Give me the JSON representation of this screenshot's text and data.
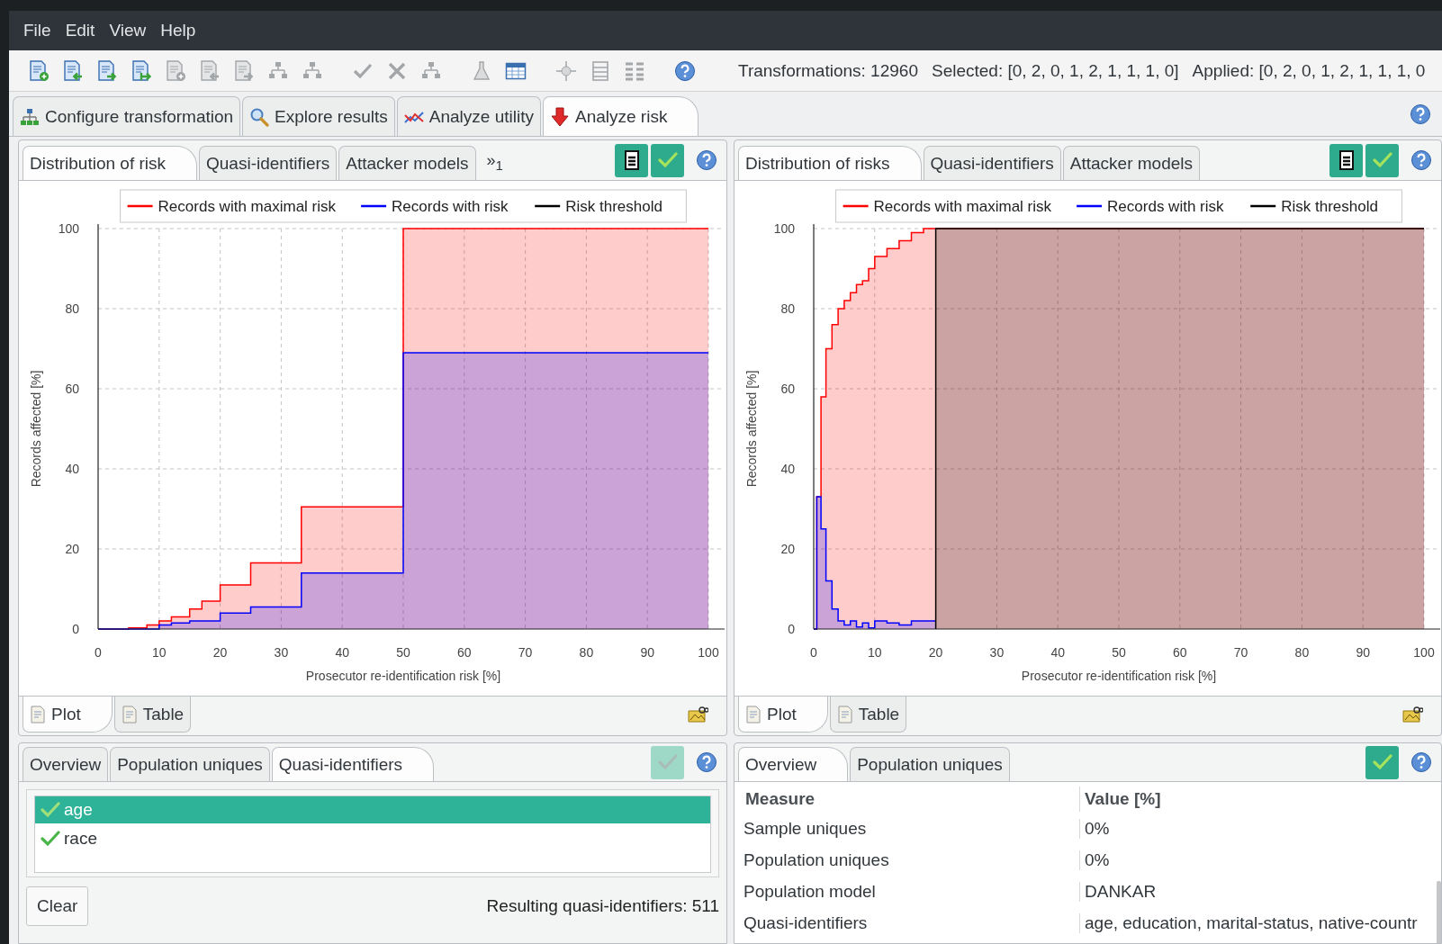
{
  "menu": [
    "File",
    "Edit",
    "View",
    "Help"
  ],
  "toolbar": {
    "buttons": [
      {
        "disabled": false
      },
      {
        "disabled": false
      },
      {
        "disabled": false
      },
      {
        "disabled": false
      },
      {
        "disabled": true
      },
      {
        "disabled": true
      },
      {
        "disabled": true
      },
      {
        "disabled": true
      },
      {
        "disabled": true
      },
      {
        "disabled": true
      },
      {
        "disabled": true
      },
      {
        "disabled": true
      },
      {
        "disabled": true
      },
      {
        "disabled": false
      },
      {
        "disabled": true
      },
      {
        "disabled": true
      },
      {
        "disabled": true
      },
      {
        "disabled": false
      }
    ],
    "transformations": "Transformations: 12960",
    "selected": "Selected: [0, 2, 0, 1, 2, 1, 1, 1, 0]",
    "applied": "Applied: [0, 2, 0, 1, 2, 1, 1, 1, 0"
  },
  "main_tabs": [
    {
      "label": "Configure transformation",
      "selected": false
    },
    {
      "label": "Explore results",
      "selected": false
    },
    {
      "label": "Analyze utility",
      "selected": false
    },
    {
      "label": "Analyze risk",
      "selected": true
    }
  ],
  "risk_panels": [
    {
      "tabs": [
        {
          "label": "Distribution of risk",
          "selected": true
        },
        {
          "label": "Quasi-identifiers",
          "selected": false
        },
        {
          "label": "Attacker models",
          "selected": false
        }
      ],
      "overflow": "»$_{1}$",
      "chart_data": {
        "type": "area",
        "xlabel": "Prosecutor re-identification risk [%]",
        "ylabel": "Records affected [%]",
        "x": [
          0,
          5,
          8,
          10,
          12,
          15,
          17,
          20,
          25,
          33.3,
          50,
          100
        ],
        "series": [
          {
            "name": "Records with maximal risk",
            "color": "#ff0000",
            "values": [
              0,
              0.3,
              1,
              2,
              3,
              5,
              7,
              11,
              16.5,
              30.5,
              100,
              100
            ]
          },
          {
            "name": "Records with risk",
            "color": "#0000ff",
            "values": [
              0,
              0,
              0,
              1,
              1.5,
              2,
              2,
              4,
              5.5,
              14,
              69,
              69
            ]
          },
          {
            "name": "Risk threshold",
            "color": "#000000",
            "values": [
              null,
              null,
              null,
              null,
              null,
              null,
              null,
              null,
              null,
              null,
              null,
              null
            ]
          }
        ],
        "xlim": [
          0,
          100
        ],
        "ylim": [
          0,
          100
        ],
        "xticks": [
          0,
          10,
          20,
          30,
          40,
          50,
          60,
          70,
          80,
          90,
          100
        ],
        "yticks": [
          0,
          20,
          40,
          60,
          80,
          100
        ],
        "grid": true,
        "legend": "top"
      },
      "view_tabs": [
        {
          "label": "Plot",
          "selected": true
        },
        {
          "label": "Table",
          "selected": false
        }
      ]
    },
    {
      "tabs": [
        {
          "label": "Distribution of risks",
          "selected": true
        },
        {
          "label": "Quasi-identifiers",
          "selected": false
        },
        {
          "label": "Attacker models",
          "selected": false
        }
      ],
      "chart_data": {
        "type": "area",
        "xlabel": "Prosecutor re-identification risk [%]",
        "ylabel": "Records affected [%]",
        "x": [
          0,
          0.3,
          0.5,
          1.2,
          2,
          3,
          4,
          5,
          6,
          7,
          8,
          9,
          10,
          12,
          14,
          15,
          16,
          18,
          20,
          20,
          100
        ],
        "series": [
          {
            "name": "Records with maximal risk",
            "color": "#ff0000",
            "values": [
              0,
              0,
              33,
              58,
              70,
              76,
              80,
              82,
              84,
              86,
              87,
              90,
              93,
              95,
              97,
              97,
              99,
              100,
              100,
              100,
              100
            ]
          },
          {
            "name": "Records with risk",
            "color": "#0000ff",
            "values": [
              0,
              0,
              33,
              25,
              12,
              5,
              2,
              1,
              2,
              0.5,
              1.5,
              0.3,
              2,
              1.5,
              1,
              1,
              2,
              2,
              2,
              null,
              null
            ]
          },
          {
            "name": "Risk threshold",
            "color": "#000000",
            "values": [
              null,
              null,
              null,
              null,
              null,
              null,
              null,
              null,
              null,
              null,
              null,
              null,
              null,
              null,
              null,
              null,
              null,
              null,
              0,
              100,
              100
            ]
          }
        ],
        "xlim": [
          0,
          100
        ],
        "ylim": [
          0,
          100
        ],
        "xticks": [
          0,
          10,
          20,
          30,
          40,
          50,
          60,
          70,
          80,
          90,
          100
        ],
        "yticks": [
          0,
          20,
          40,
          60,
          80,
          100
        ],
        "grid": true,
        "legend": "top"
      },
      "view_tabs": [
        {
          "label": "Plot",
          "selected": true
        },
        {
          "label": "Table",
          "selected": false
        }
      ]
    }
  ],
  "qi_panel": {
    "tabs": [
      {
        "label": "Overview",
        "selected": false
      },
      {
        "label": "Population uniques",
        "selected": false
      },
      {
        "label": "Quasi-identifiers",
        "selected": true
      }
    ],
    "apply_disabled": true,
    "items": [
      {
        "label": "age",
        "checked": true,
        "selected": true
      },
      {
        "label": "race",
        "checked": true,
        "selected": false
      }
    ],
    "clear_button": "Clear",
    "result": "Resulting quasi-identifiers: 511"
  },
  "measures_panel": {
    "tabs": [
      {
        "label": "Overview",
        "selected": true
      },
      {
        "label": "Population uniques",
        "selected": false
      }
    ],
    "apply_disabled": false,
    "columns": [
      "Measure",
      "Value [%]"
    ],
    "rows": [
      [
        "Sample uniques",
        "0%"
      ],
      [
        "Population uniques",
        "0%"
      ],
      [
        "Population model",
        "DANKAR"
      ],
      [
        "Quasi-identifiers",
        "age, education, marital-status, native-countr"
      ]
    ]
  }
}
